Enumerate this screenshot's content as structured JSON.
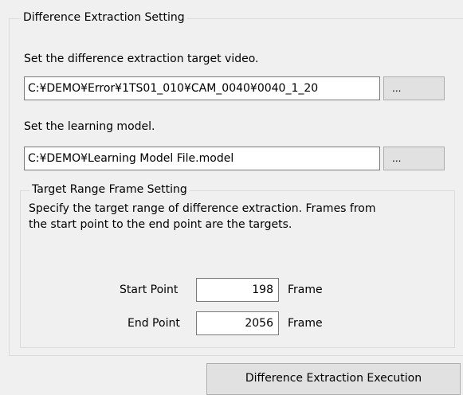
{
  "outer_group": {
    "title": "Difference Extraction Setting",
    "video_label": "Set the difference extraction target video.",
    "video_path": "C:¥DEMO¥Error¥1TS01_010¥CAM_0040¥0040_1_20",
    "video_browse_label": "...",
    "model_label": "Set the learning model.",
    "model_path": "C:¥DEMO¥Learning Model File.model",
    "model_browse_label": "..."
  },
  "frame_group": {
    "title": "Target Range Frame Setting",
    "description_line1": "Specify the target range of difference extraction. Frames from",
    "description_line2": "the start point to the end point are the targets.",
    "start_label": "Start Point",
    "start_value": "198",
    "start_unit": "Frame",
    "end_label": "End Point",
    "end_value": "2056",
    "end_unit": "Frame"
  },
  "execute_button_label": "Difference Extraction Execution"
}
